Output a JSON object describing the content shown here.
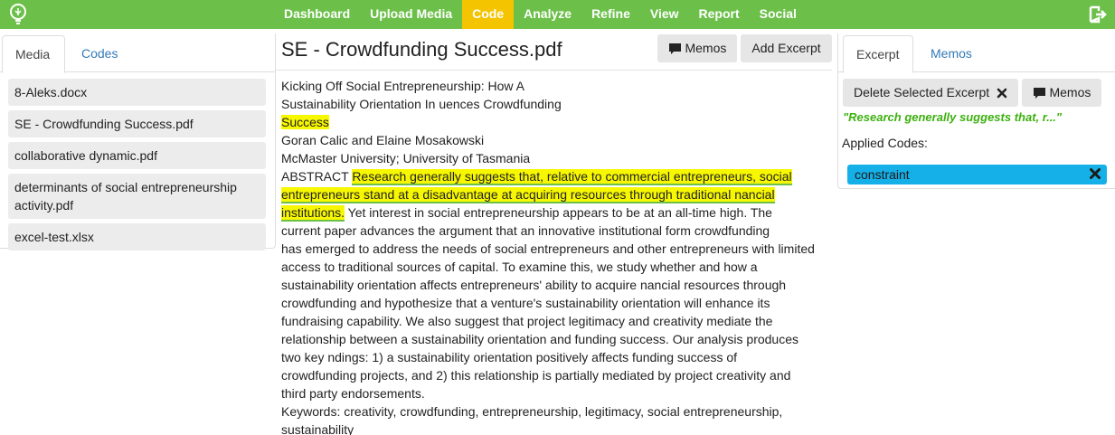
{
  "nav": {
    "items": [
      {
        "label": "Dashboard",
        "active": false
      },
      {
        "label": "Upload Media",
        "active": false
      },
      {
        "label": "Code",
        "active": true
      },
      {
        "label": "Analyze",
        "active": false
      },
      {
        "label": "Refine",
        "active": false
      },
      {
        "label": "View",
        "active": false
      },
      {
        "label": "Report",
        "active": false
      },
      {
        "label": "Social",
        "active": false
      }
    ],
    "logo_icon": "lightbulb-icon",
    "logout_icon": "logout-icon"
  },
  "left_panel": {
    "tabs": [
      "Media",
      "Codes"
    ],
    "files": [
      "8-Aleks.docx",
      "SE - Crowdfunding Success.pdf",
      "collaborative dynamic.pdf",
      "determinants of social entrepreneurship activity.pdf",
      "excel-test.xlsx"
    ]
  },
  "document": {
    "title": "SE - Crowdfunding Success.pdf",
    "memos_label": "Memos",
    "add_excerpt_label": "Add Excerpt",
    "lines": {
      "l1": "Kicking Off Social Entrepreneurship: How A",
      "l2": "Sustainability Orientation In uences Crowdfunding",
      "l3": "Success",
      "l4": "Goran Calic and Elaine Mosakowski",
      "l5": "McMaster University; University of Tasmania",
      "l6a": "ABSTRACT ",
      "l6b": "Research generally suggests that, relative to commercial entrepreneurs, social",
      "l7": "entrepreneurs stand at a disadvantage at acquiring resources through traditional nancial",
      "l8a": "institutions.",
      "l8b": " Yet interest in social entrepreneurship appears to be at an all-time high. The",
      "l9": "current paper advances the argument that an innovative institutional form crowdfunding",
      "l10": "has emerged to address the needs of social entrepreneurs and other entrepreneurs with limited",
      "l11": "access to traditional sources of capital. To examine this, we study whether and how a",
      "l12": "sustainability orientation affects entrepreneurs' ability to acquire nancial resources through",
      "l13": "crowdfunding and hypothesize that a venture's sustainability orientation will enhance its",
      "l14": "fundraising capability. We also suggest that project legitimacy and creativity mediate the",
      "l15": "relationship between a sustainability orientation and funding success. Our analysis produces",
      "l16": "two key ndings: 1) a sustainability orientation positively affects funding success of",
      "l17": "crowdfunding projects, and 2) this relationship is partially mediated by project creativity and",
      "l18": "third party endorsements.",
      "l19": "Keywords: creativity, crowdfunding, entrepreneurship, legitimacy, social entrepreneurship,",
      "l20": "sustainability"
    }
  },
  "right_panel": {
    "tabs": [
      "Excerpt",
      "Memos"
    ],
    "delete_label": "Delete Selected Excerpt",
    "memos_label": "Memos",
    "excerpt_quote": "\"Research generally suggests that, r...\"",
    "applied_codes_label": "Applied Codes:",
    "codes": [
      "constraint"
    ]
  },
  "colors": {
    "nav_green": "#6cc04a",
    "nav_active": "#f5c400",
    "highlight": "#f7f700",
    "code_blue": "#15b0e8",
    "quote_green": "#3cb10f",
    "link_blue": "#337ab7"
  }
}
